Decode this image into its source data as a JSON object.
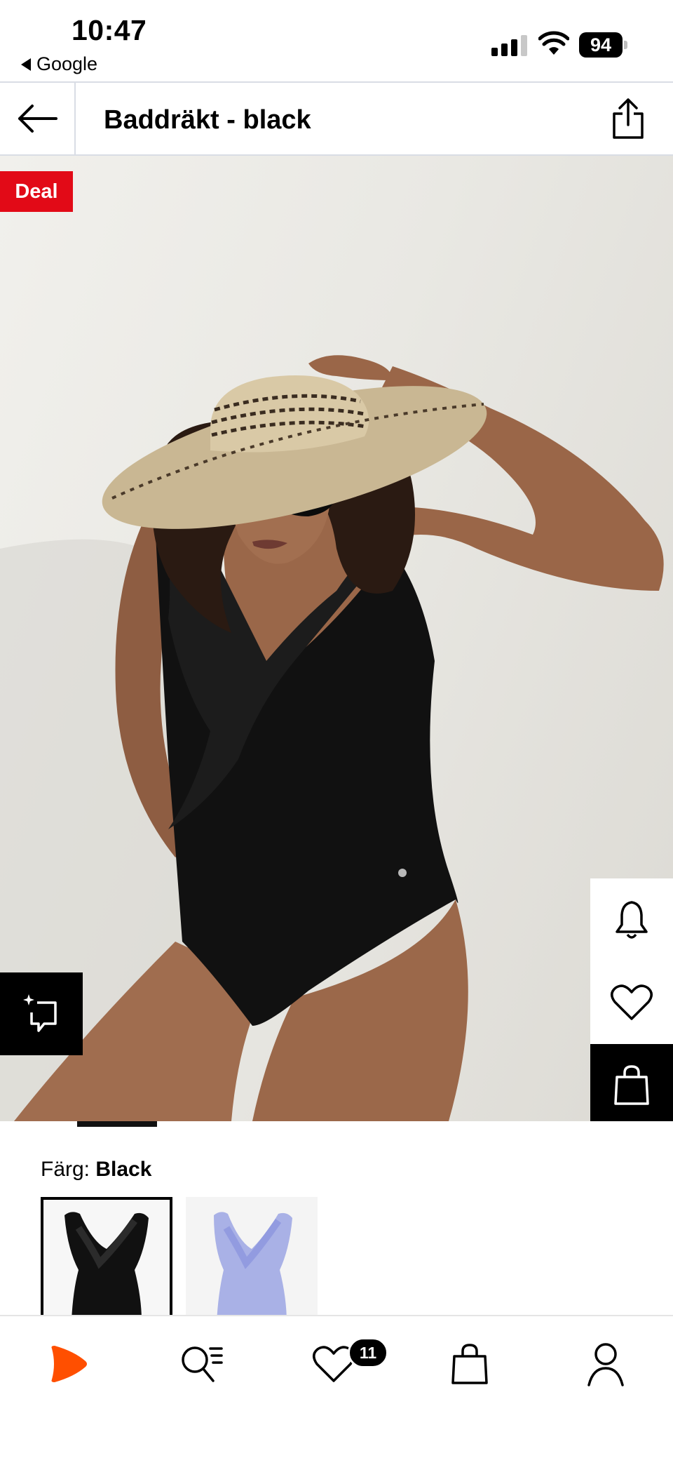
{
  "status_bar": {
    "time": "10:47",
    "back_app": "Google",
    "battery": "94",
    "icons": [
      "signal-icon",
      "wifi-icon",
      "battery-icon"
    ]
  },
  "header": {
    "title": "Baddräkt - black",
    "icons": [
      "back-arrow-icon",
      "share-icon"
    ]
  },
  "product": {
    "badge": "Deal",
    "actions": [
      "compare-icon",
      "bell-icon",
      "heart-icon",
      "shopping-bag-icon"
    ]
  },
  "color": {
    "label": "Färg:",
    "selected": "Black",
    "swatches": [
      "black",
      "lavender blue"
    ],
    "colors": {
      "black": "#111111",
      "lavender": "#a9b1e6"
    }
  },
  "bottom_nav": {
    "items": [
      "home-logo-icon",
      "search-list-icon",
      "favorites-heart-icon",
      "cart-bag-icon",
      "profile-icon"
    ],
    "favorites_count": "11",
    "brand_color": "#ff4f00"
  },
  "theme": {
    "deal_red": "#e20a17",
    "divider": "#d9dde5"
  }
}
